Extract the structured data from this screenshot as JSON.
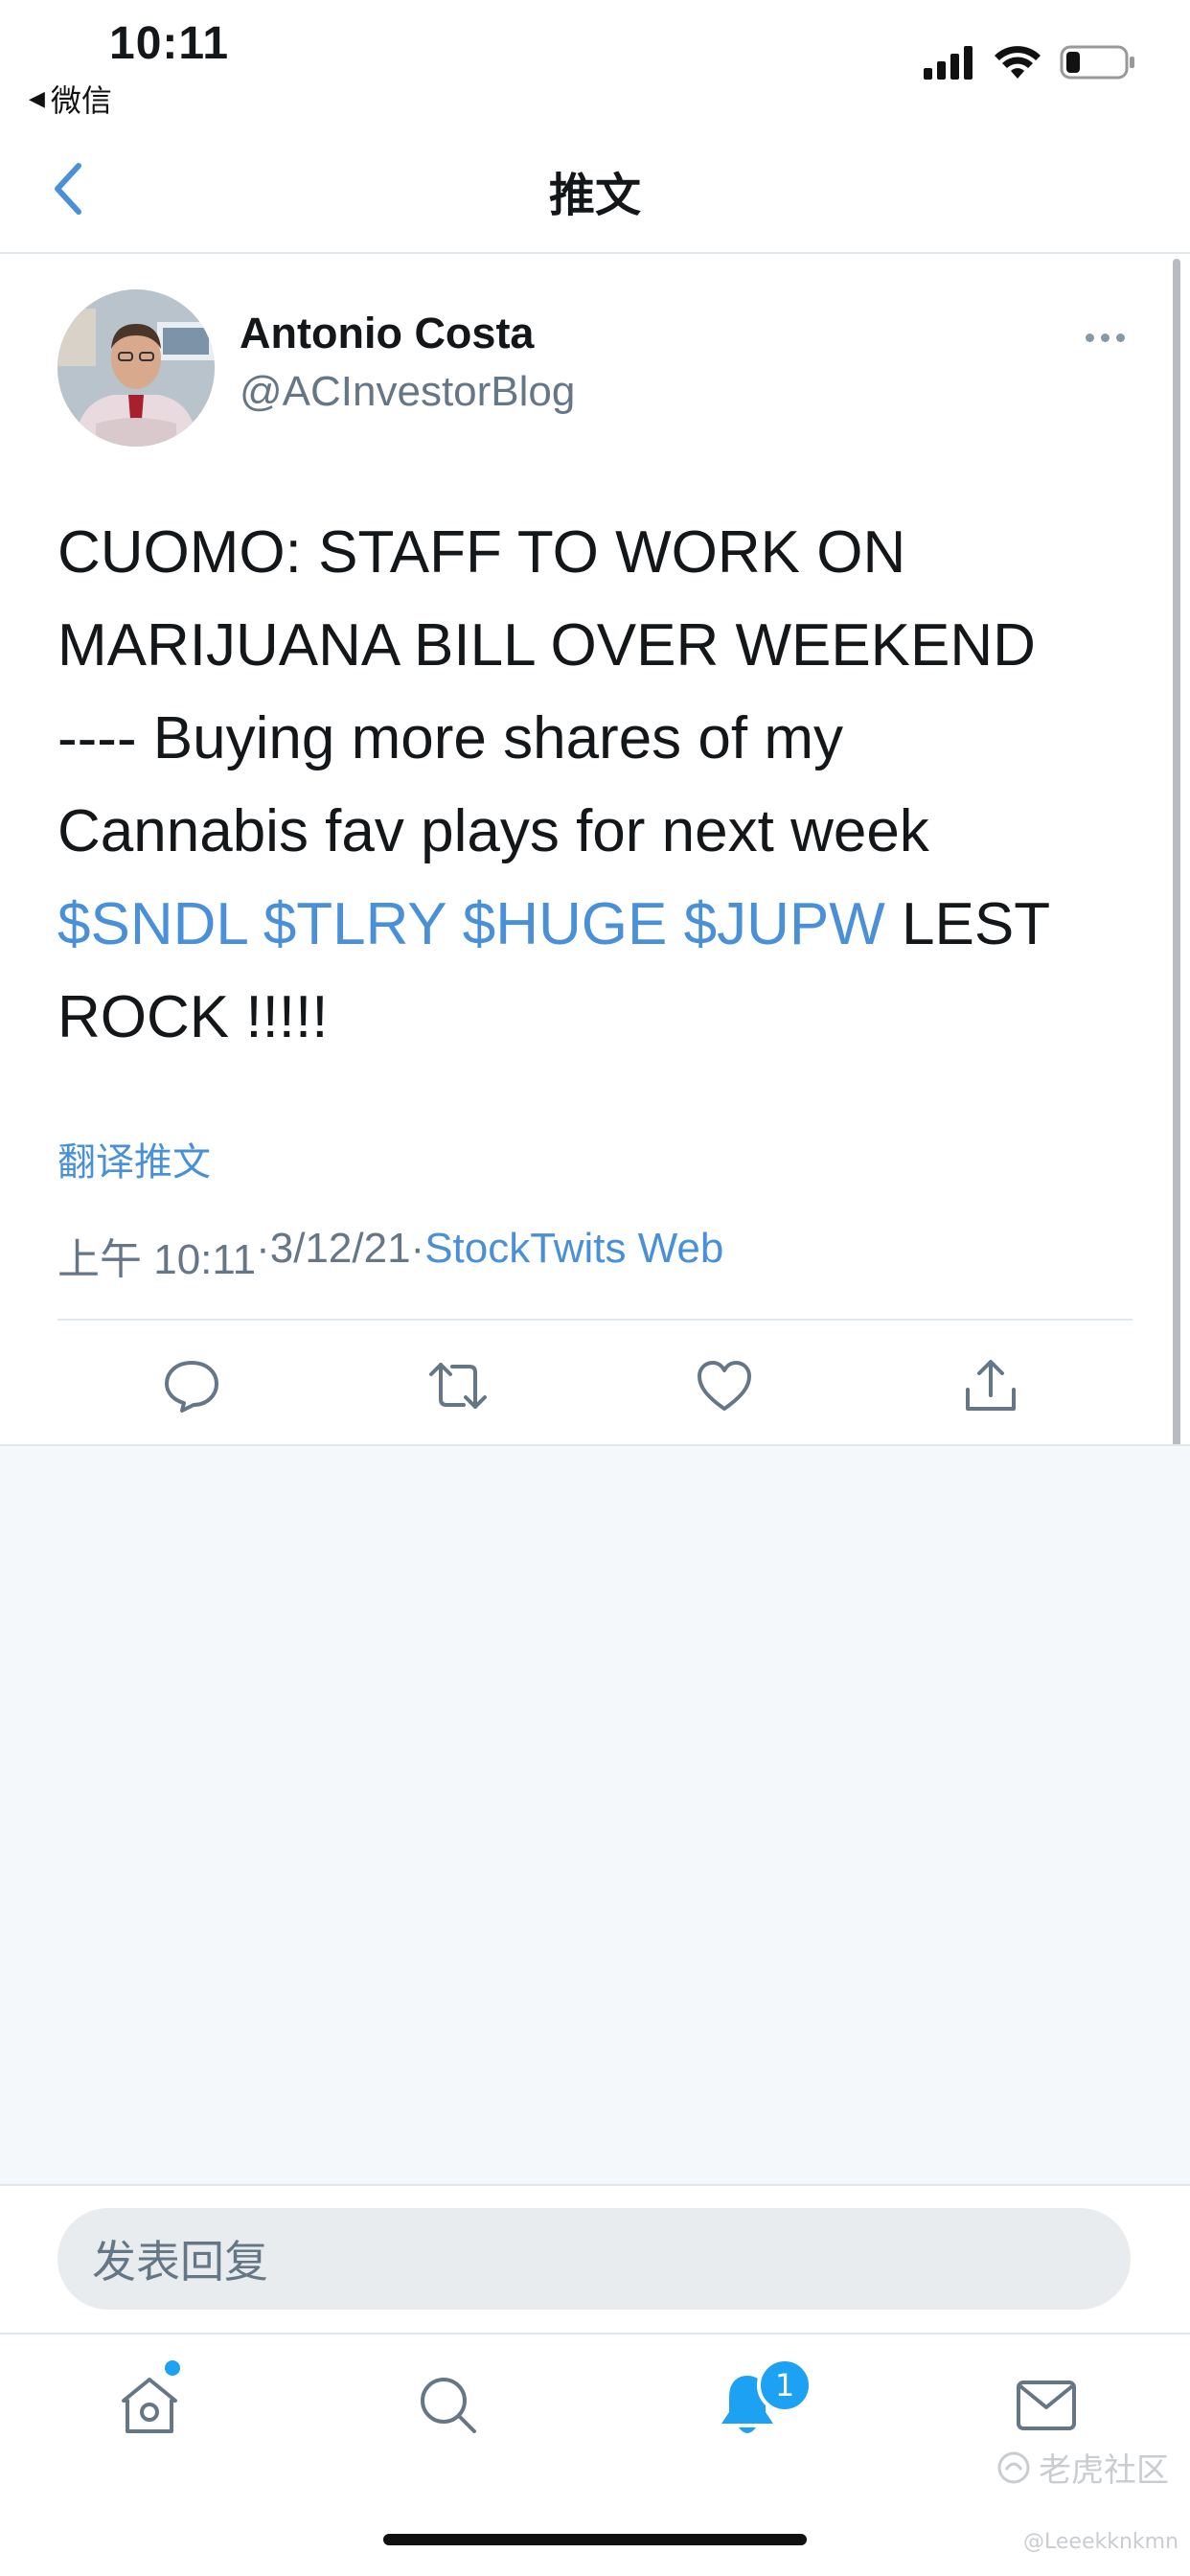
{
  "status_bar": {
    "time": "10:11",
    "back_app": "微信",
    "icons": [
      "cellular-signal-icon",
      "wifi-icon",
      "battery-icon"
    ]
  },
  "nav": {
    "title": "推文",
    "back_icon": "chevron-left-icon"
  },
  "tweet": {
    "author_name": "Antonio Costa",
    "author_handle": "@ACInvestorBlog",
    "text_lines": [
      "CUOMO: STAFF TO WORK ON",
      "MARIJUANA BILL OVER WEEKEND",
      "---- Buying more shares of my",
      "Cannabis fav plays for next week"
    ],
    "cashtags": [
      "$SNDL",
      "$TLRY",
      "$HUGE",
      "$JUPW"
    ],
    "text_tail_1": "LEST",
    "text_tail_2": "ROCK !!!!!",
    "translate_label": "翻译推文",
    "time": "上午 10:11",
    "date": "3/12/21",
    "separator": " · ",
    "source": "StockTwits Web",
    "actions": [
      "reply-icon",
      "retweet-icon",
      "like-icon",
      "share-icon"
    ]
  },
  "reply": {
    "placeholder": "发表回复"
  },
  "tabbar": {
    "tabs": [
      "home-icon",
      "search-icon",
      "notifications-icon",
      "messages-icon"
    ],
    "notification_badge": "1"
  },
  "watermark": {
    "text": "老虎社区",
    "sub": "@Leeekknkmn"
  },
  "colors": {
    "accent": "#1da1f2",
    "link": "#4a90d9",
    "secondary_text": "#657786",
    "divider": "#e1e8ed",
    "background_gray": "#f5f8fa"
  }
}
